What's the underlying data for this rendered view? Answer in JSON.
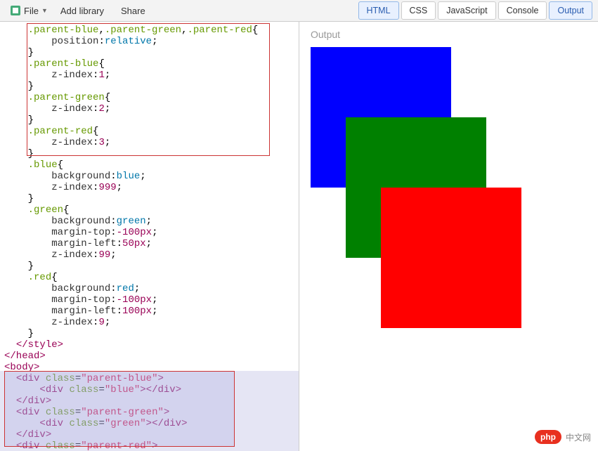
{
  "toolbar": {
    "file_label": "File",
    "add_library_label": "Add library",
    "share_label": "Share"
  },
  "tabs": {
    "html": "HTML",
    "css": "CSS",
    "javascript": "JavaScript",
    "console": "Console",
    "output": "Output"
  },
  "output": {
    "header": "Output"
  },
  "watermark": {
    "badge": "php",
    "text": "中文网"
  },
  "code": {
    "css_lines": [
      {
        "indent": 2,
        "tokens": [
          [
            "sel",
            ".parent-blue"
          ],
          [
            "",
            ","
          ],
          [
            "sel",
            ".parent-green"
          ],
          [
            "",
            ","
          ],
          [
            "sel",
            ".parent-red"
          ],
          [
            "",
            "{"
          ]
        ]
      },
      {
        "indent": 4,
        "tokens": [
          [
            "prop",
            "position"
          ],
          [
            "",
            ":"
          ],
          [
            "val",
            "relative"
          ],
          [
            "",
            ";"
          ]
        ]
      },
      {
        "indent": 2,
        "tokens": [
          [
            "",
            "}"
          ]
        ]
      },
      {
        "indent": 2,
        "tokens": [
          [
            "sel",
            ".parent-blue"
          ],
          [
            "",
            "{"
          ]
        ]
      },
      {
        "indent": 4,
        "tokens": [
          [
            "prop",
            "z-index"
          ],
          [
            "",
            ":"
          ],
          [
            "num",
            "1"
          ],
          [
            "",
            ";"
          ]
        ]
      },
      {
        "indent": 2,
        "tokens": [
          [
            "",
            "}"
          ]
        ]
      },
      {
        "indent": 2,
        "tokens": [
          [
            "sel",
            ".parent-green"
          ],
          [
            "",
            "{"
          ]
        ]
      },
      {
        "indent": 4,
        "tokens": [
          [
            "prop",
            "z-index"
          ],
          [
            "",
            ":"
          ],
          [
            "num",
            "2"
          ],
          [
            "",
            ";"
          ]
        ]
      },
      {
        "indent": 2,
        "tokens": [
          [
            "",
            "}"
          ]
        ]
      },
      {
        "indent": 2,
        "tokens": [
          [
            "sel",
            ".parent-red"
          ],
          [
            "",
            "{"
          ]
        ]
      },
      {
        "indent": 4,
        "tokens": [
          [
            "prop",
            "z-index"
          ],
          [
            "",
            ":"
          ],
          [
            "num",
            "3"
          ],
          [
            "",
            ";"
          ]
        ]
      },
      {
        "indent": 2,
        "tokens": [
          [
            "",
            "}"
          ]
        ]
      },
      {
        "indent": 2,
        "tokens": [
          [
            "sel",
            ".blue"
          ],
          [
            "",
            "{"
          ]
        ]
      },
      {
        "indent": 4,
        "tokens": [
          [
            "prop",
            "background"
          ],
          [
            "",
            ":"
          ],
          [
            "val",
            "blue"
          ],
          [
            "",
            ";"
          ]
        ]
      },
      {
        "indent": 4,
        "tokens": [
          [
            "prop",
            "z-index"
          ],
          [
            "",
            ":"
          ],
          [
            "num",
            "999"
          ],
          [
            "",
            ";"
          ]
        ]
      },
      {
        "indent": 2,
        "tokens": [
          [
            "",
            "}"
          ]
        ]
      },
      {
        "indent": 2,
        "tokens": [
          [
            "sel",
            ".green"
          ],
          [
            "",
            "{"
          ]
        ]
      },
      {
        "indent": 4,
        "tokens": [
          [
            "prop",
            "background"
          ],
          [
            "",
            ":"
          ],
          [
            "val",
            "green"
          ],
          [
            "",
            ";"
          ]
        ]
      },
      {
        "indent": 4,
        "tokens": [
          [
            "prop",
            "margin-top"
          ],
          [
            "",
            ":"
          ],
          [
            "num",
            "-100px"
          ],
          [
            "",
            ";"
          ]
        ]
      },
      {
        "indent": 4,
        "tokens": [
          [
            "prop",
            "margin-left"
          ],
          [
            "",
            ":"
          ],
          [
            "num",
            "50px"
          ],
          [
            "",
            ";"
          ]
        ]
      },
      {
        "indent": 4,
        "tokens": [
          [
            "prop",
            "z-index"
          ],
          [
            "",
            ":"
          ],
          [
            "num",
            "99"
          ],
          [
            "",
            ";"
          ]
        ]
      },
      {
        "indent": 2,
        "tokens": [
          [
            "",
            "}"
          ]
        ]
      },
      {
        "indent": 2,
        "tokens": [
          [
            "sel",
            ".red"
          ],
          [
            "",
            "{"
          ]
        ]
      },
      {
        "indent": 4,
        "tokens": [
          [
            "prop",
            "background"
          ],
          [
            "",
            ":"
          ],
          [
            "val",
            "red"
          ],
          [
            "",
            ";"
          ]
        ]
      },
      {
        "indent": 4,
        "tokens": [
          [
            "prop",
            "margin-top"
          ],
          [
            "",
            ":"
          ],
          [
            "num",
            "-100px"
          ],
          [
            "",
            ";"
          ]
        ]
      },
      {
        "indent": 4,
        "tokens": [
          [
            "prop",
            "margin-left"
          ],
          [
            "",
            ":"
          ],
          [
            "num",
            "100px"
          ],
          [
            "",
            ";"
          ]
        ]
      },
      {
        "indent": 4,
        "tokens": [
          [
            "prop",
            "z-index"
          ],
          [
            "",
            ":"
          ],
          [
            "num",
            "9"
          ],
          [
            "",
            ";"
          ]
        ]
      },
      {
        "indent": 2,
        "tokens": [
          [
            "",
            "}"
          ]
        ]
      },
      {
        "indent": 1,
        "tokens": [
          [
            "tag",
            "</style>"
          ]
        ]
      },
      {
        "indent": 0,
        "tokens": [
          [
            "tag",
            "</head>"
          ]
        ]
      },
      {
        "indent": 0,
        "tokens": [
          [
            "tag",
            "<body>"
          ]
        ]
      },
      {
        "indent": 1,
        "tokens": [
          [
            "tag",
            "<div "
          ],
          [
            "attr",
            "class"
          ],
          [
            "",
            "="
          ],
          [
            "str",
            "\"parent-blue\""
          ],
          [
            "tag",
            ">"
          ]
        ]
      },
      {
        "indent": 3,
        "tokens": [
          [
            "tag",
            "<div "
          ],
          [
            "attr",
            "class"
          ],
          [
            "",
            "="
          ],
          [
            "str",
            "\"blue\""
          ],
          [
            "tag",
            "></div>"
          ]
        ]
      },
      {
        "indent": 1,
        "tokens": [
          [
            "tag",
            "</div>"
          ]
        ]
      },
      {
        "indent": 1,
        "tokens": [
          [
            "tag",
            "<div "
          ],
          [
            "attr",
            "class"
          ],
          [
            "",
            "="
          ],
          [
            "str",
            "\"parent-green\""
          ],
          [
            "tag",
            ">"
          ]
        ]
      },
      {
        "indent": 3,
        "tokens": [
          [
            "tag",
            "<div "
          ],
          [
            "attr",
            "class"
          ],
          [
            "",
            "="
          ],
          [
            "str",
            "\"green\""
          ],
          [
            "tag",
            "></div>"
          ]
        ]
      },
      {
        "indent": 1,
        "tokens": [
          [
            "tag",
            "</div>"
          ]
        ]
      },
      {
        "indent": 1,
        "tokens": [
          [
            "tag",
            "<div "
          ],
          [
            "attr",
            "class"
          ],
          [
            "",
            "="
          ],
          [
            "str",
            "\"parent-red\""
          ],
          [
            "tag",
            ">"
          ]
        ]
      }
    ]
  }
}
